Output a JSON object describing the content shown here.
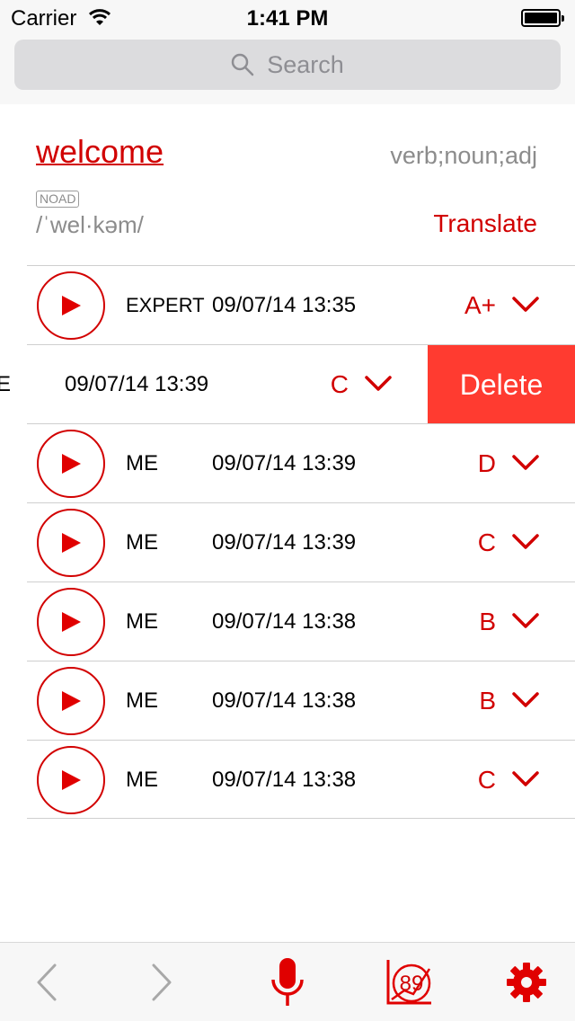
{
  "status_bar": {
    "carrier": "Carrier",
    "time": "1:41 PM"
  },
  "search": {
    "placeholder": "Search"
  },
  "entry": {
    "word": "welcome",
    "part_of_speech": "verb;noun;adj",
    "source_badge": "NOAD",
    "pronunciation": "/ˈwel·kəm/",
    "translate_label": "Translate"
  },
  "recordings": [
    {
      "speaker": "EXPERT",
      "timestamp": "09/07/14 13:35",
      "grade": "A+"
    },
    {
      "speaker": "ME",
      "timestamp": "09/07/14 13:39",
      "grade": "C",
      "swiped": true
    },
    {
      "speaker": "ME",
      "timestamp": "09/07/14 13:39",
      "grade": "D"
    },
    {
      "speaker": "ME",
      "timestamp": "09/07/14 13:39",
      "grade": "C"
    },
    {
      "speaker": "ME",
      "timestamp": "09/07/14 13:38",
      "grade": "B"
    },
    {
      "speaker": "ME",
      "timestamp": "09/07/14 13:38",
      "grade": "B"
    },
    {
      "speaker": "ME",
      "timestamp": "09/07/14 13:38",
      "grade": "C"
    }
  ],
  "delete_label": "Delete",
  "toolbar": {
    "score": "89",
    "icons": [
      "back-arrow-icon",
      "forward-arrow-icon",
      "microphone-icon",
      "score-chart-icon",
      "settings-gear-icon"
    ]
  },
  "colors": {
    "accent": "#d10000",
    "delete": "#ff3b30",
    "muted_text": "#8c8c8c"
  }
}
